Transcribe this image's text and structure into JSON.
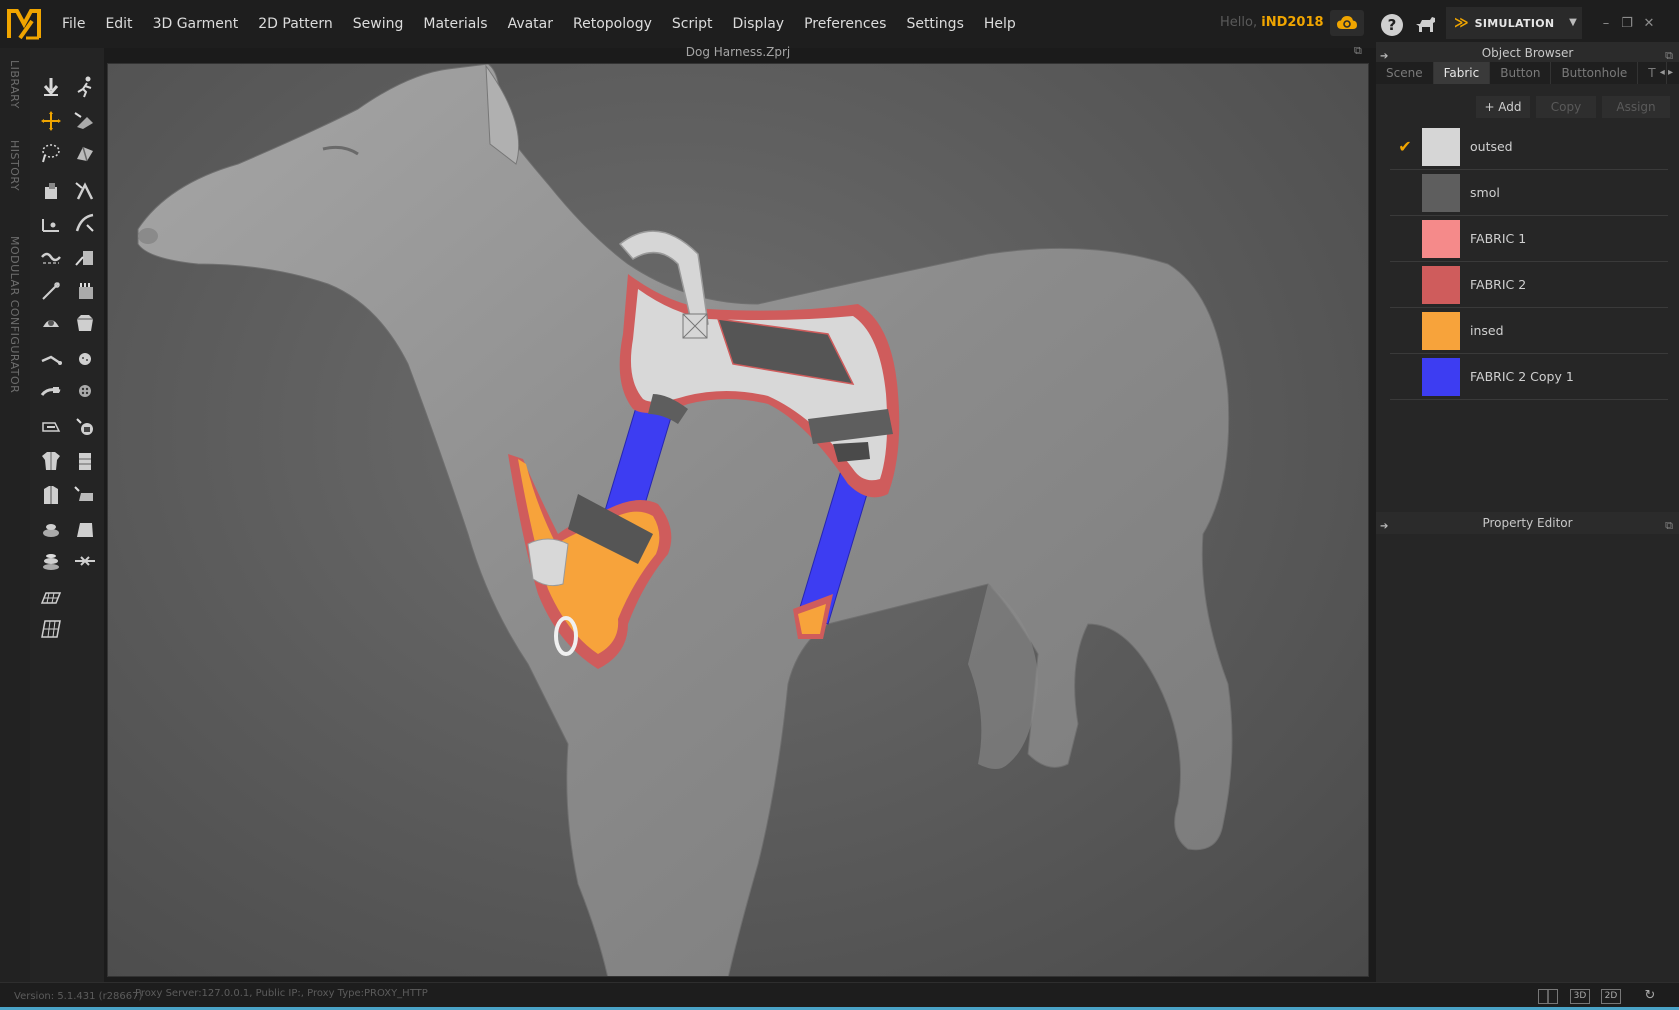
{
  "app": {
    "logo_icon": "md-logo-icon",
    "accent_color": "#f0a500"
  },
  "menu": [
    "File",
    "Edit",
    "3D Garment",
    "2D Pattern",
    "Sewing",
    "Materials",
    "Avatar",
    "Retopology",
    "Script",
    "Display",
    "Preferences",
    "Settings",
    "Help"
  ],
  "user": {
    "greeting": "Hello,",
    "name": "iND2018"
  },
  "mode": {
    "label": "SIMULATION"
  },
  "left_tabs": [
    "LIBRARY",
    "HISTORY",
    "MODULAR CONFIGURATOR"
  ],
  "viewport": {
    "title": "Dog Harness.Zprj"
  },
  "object_browser": {
    "title": "Object Browser",
    "tabs": [
      "Scene",
      "Fabric",
      "Button",
      "Buttonhole",
      "T"
    ],
    "active_tab": "Fabric",
    "actions": {
      "add": "+ Add",
      "copy": "Copy",
      "assign": "Assign"
    },
    "fabrics": [
      {
        "name": "outsed",
        "color": "#d6d6d6",
        "selected": true
      },
      {
        "name": "smol",
        "color": "#5e5e5e",
        "selected": false
      },
      {
        "name": "FABRIC 1",
        "color": "#f58a8a",
        "selected": false
      },
      {
        "name": "FABRIC 2",
        "color": "#cf5c5c",
        "selected": false
      },
      {
        "name": "insed",
        "color": "#f7a33b",
        "selected": false
      },
      {
        "name": "FABRIC 2 Copy 1",
        "color": "#3d3df2",
        "selected": false
      }
    ]
  },
  "property_editor": {
    "title": "Property Editor"
  },
  "status": {
    "version": "Version: 5.1.431 (r28667)",
    "proxy": "Proxy Server:127.0.0.1, Public IP:, Proxy Type:PROXY_HTTP"
  },
  "view_modes": [
    "",
    "3D",
    "2D"
  ]
}
